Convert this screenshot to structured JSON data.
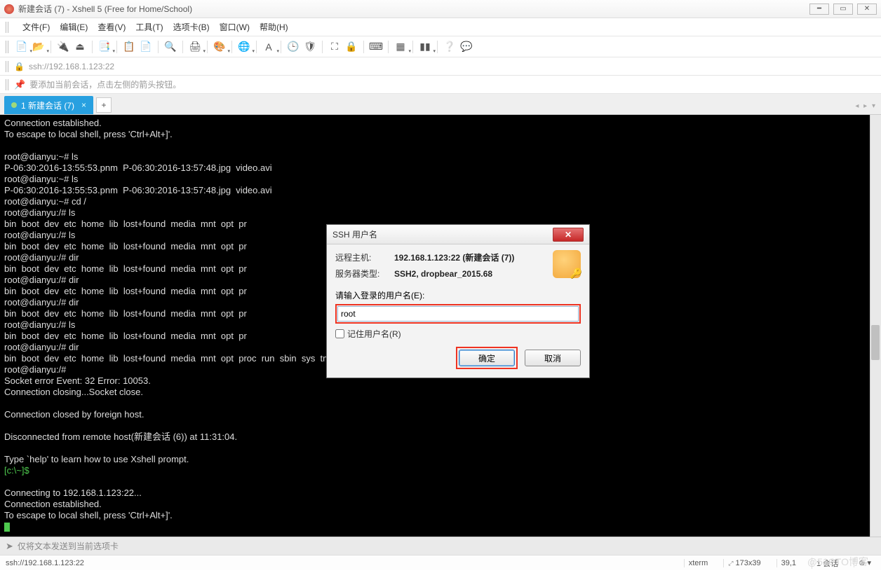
{
  "window": {
    "title": "新建会话 (7) - Xshell 5 (Free for Home/School)"
  },
  "menu": {
    "items": [
      "文件(F)",
      "编辑(E)",
      "查看(V)",
      "工具(T)",
      "选项卡(B)",
      "窗口(W)",
      "帮助(H)"
    ]
  },
  "addressbar": {
    "url": "ssh://192.168.1.123:22"
  },
  "infobar": {
    "text": "要添加当前会话，点击左侧的箭头按钮。"
  },
  "tabs": {
    "active": "1 新建会话 (7)"
  },
  "terminal": {
    "l01": "Connection established.",
    "l02": "To escape to local shell, press 'Ctrl+Alt+]'.",
    "l03": "",
    "l04": "root@dianyu:~# ls",
    "l05": "P-06:30:2016-13:55:53.pnm  P-06:30:2016-13:57:48.jpg  video.avi",
    "l06": "root@dianyu:~# ls",
    "l07": "P-06:30:2016-13:55:53.pnm  P-06:30:2016-13:57:48.jpg  video.avi",
    "l08": "root@dianyu:~# cd /",
    "l09": "root@dianyu:/# ls",
    "l10": "bin  boot  dev  etc  home  lib  lost+found  media  mnt  opt  pr",
    "l11": "root@dianyu:/# ls",
    "l12": "bin  boot  dev  etc  home  lib  lost+found  media  mnt  opt  pr",
    "l13": "root@dianyu:/# dir",
    "l14": "bin  boot  dev  etc  home  lib  lost+found  media  mnt  opt  pr",
    "l15": "root@dianyu:/# dir",
    "l16": "bin  boot  dev  etc  home  lib  lost+found  media  mnt  opt  pr",
    "l17": "root@dianyu:/# dir",
    "l18": "bin  boot  dev  etc  home  lib  lost+found  media  mnt  opt  pr",
    "l19": "root@dianyu:/# ls",
    "l20": "bin  boot  dev  etc  home  lib  lost+found  media  mnt  opt  pr",
    "l21": "root@dianyu:/# dir",
    "l22": "bin  boot  dev  etc  home  lib  lost+found  media  mnt  opt  proc  run  sbin  sys  tmp  unit_tests  usr  var",
    "l23": "root@dianyu:/#",
    "l24": "Socket error Event: 32 Error: 10053.",
    "l25": "Connection closing...Socket close.",
    "l26": "",
    "l27": "Connection closed by foreign host.",
    "l28": "",
    "l29": "Disconnected from remote host(新建会话 (6)) at 11:31:04.",
    "l30": "",
    "l31": "Type `help' to learn how to use Xshell prompt.",
    "l32": "[c:\\~]$",
    "l33": "",
    "l34": "Connecting to 192.168.1.123:22...",
    "l35": "Connection established.",
    "l36": "To escape to local shell, press 'Ctrl+Alt+]'."
  },
  "sendbar": {
    "text": "仅将文本发送到当前选项卡"
  },
  "status": {
    "path": "ssh://192.168.1.123:22",
    "term": "xterm",
    "size": "173x39",
    "pos": "39,1",
    "sessions": "1 会话",
    "sizeico": "⇵"
  },
  "dialog": {
    "title": "SSH 用户名",
    "host_label": "远程主机:",
    "host_value": "192.168.1.123:22 (新建会话 (7))",
    "type_label": "服务器类型:",
    "type_value": "SSH2, dropbear_2015.68",
    "prompt": "请输入登录的用户名(E):",
    "username": "root",
    "remember": "记住用户名(R)",
    "ok": "确定",
    "cancel": "取消"
  },
  "watermark": "@51CTO博客"
}
